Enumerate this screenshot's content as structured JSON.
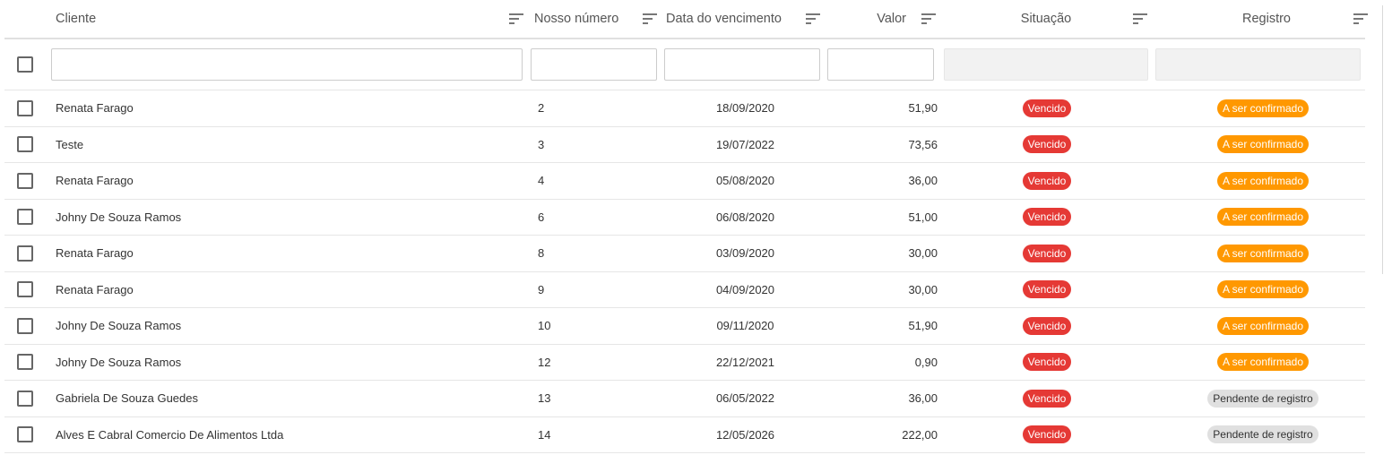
{
  "columns": {
    "cliente": "Cliente",
    "nosso_numero": "Nosso número",
    "data_vencimento": "Data do vencimento",
    "valor": "Valor",
    "situacao": "Situação",
    "registro": "Registro"
  },
  "icons": {
    "sort": "sort-icon",
    "checkbox": "checkbox-icon"
  },
  "colors": {
    "vencido": "#e53935",
    "a_ser_confirmado": "#ff9800",
    "pendente": "#e0e0e0"
  },
  "rows": [
    {
      "cliente": "Renata Farago",
      "nosso_numero": "2",
      "data": "18/09/2020",
      "valor": "51,90",
      "situacao": "Vencido",
      "registro": "A ser confirmado",
      "registro_tipo": "orange"
    },
    {
      "cliente": "Teste",
      "nosso_numero": "3",
      "data": "19/07/2022",
      "valor": "73,56",
      "situacao": "Vencido",
      "registro": "A ser confirmado",
      "registro_tipo": "orange"
    },
    {
      "cliente": "Renata Farago",
      "nosso_numero": "4",
      "data": "05/08/2020",
      "valor": "36,00",
      "situacao": "Vencido",
      "registro": "A ser confirmado",
      "registro_tipo": "orange"
    },
    {
      "cliente": "Johny De Souza Ramos",
      "nosso_numero": "6",
      "data": "06/08/2020",
      "valor": "51,00",
      "situacao": "Vencido",
      "registro": "A ser confirmado",
      "registro_tipo": "orange"
    },
    {
      "cliente": "Renata Farago",
      "nosso_numero": "8",
      "data": "03/09/2020",
      "valor": "30,00",
      "situacao": "Vencido",
      "registro": "A ser confirmado",
      "registro_tipo": "orange"
    },
    {
      "cliente": "Renata Farago",
      "nosso_numero": "9",
      "data": "04/09/2020",
      "valor": "30,00",
      "situacao": "Vencido",
      "registro": "A ser confirmado",
      "registro_tipo": "orange"
    },
    {
      "cliente": "Johny De Souza Ramos",
      "nosso_numero": "10",
      "data": "09/11/2020",
      "valor": "51,90",
      "situacao": "Vencido",
      "registro": "A ser confirmado",
      "registro_tipo": "orange"
    },
    {
      "cliente": "Johny De Souza Ramos",
      "nosso_numero": "12",
      "data": "22/12/2021",
      "valor": "0,90",
      "situacao": "Vencido",
      "registro": "A ser confirmado",
      "registro_tipo": "orange"
    },
    {
      "cliente": "Gabriela De Souza Guedes",
      "nosso_numero": "13",
      "data": "06/05/2022",
      "valor": "36,00",
      "situacao": "Vencido",
      "registro": "Pendente de registro",
      "registro_tipo": "grey"
    },
    {
      "cliente": "Alves E Cabral Comercio De Alimentos Ltda",
      "nosso_numero": "14",
      "data": "12/05/2026",
      "valor": "222,00",
      "situacao": "Vencido",
      "registro": "Pendente de registro",
      "registro_tipo": "grey"
    }
  ]
}
